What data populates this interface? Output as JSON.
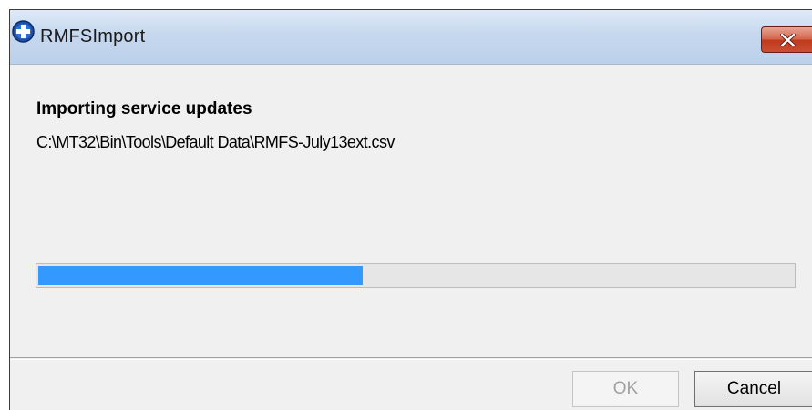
{
  "window": {
    "title": "RMFSImport",
    "icon": "blue-cross-app-icon",
    "close_icon": "close-icon"
  },
  "main": {
    "heading": "Importing service updates",
    "file_path": "C:\\MT32\\Bin\\Tools\\Default Data\\RMFS-July13ext.csv"
  },
  "progress": {
    "fraction": 0.43,
    "color": "#3399ff"
  },
  "buttons": {
    "ok": {
      "mnemonic": "O",
      "rest": "K",
      "enabled": false
    },
    "cancel": {
      "mnemonic": "C",
      "rest": "ancel",
      "enabled": true
    }
  },
  "colors": {
    "close_button": "#c94f34",
    "titlebar": "#c6d8ee"
  }
}
